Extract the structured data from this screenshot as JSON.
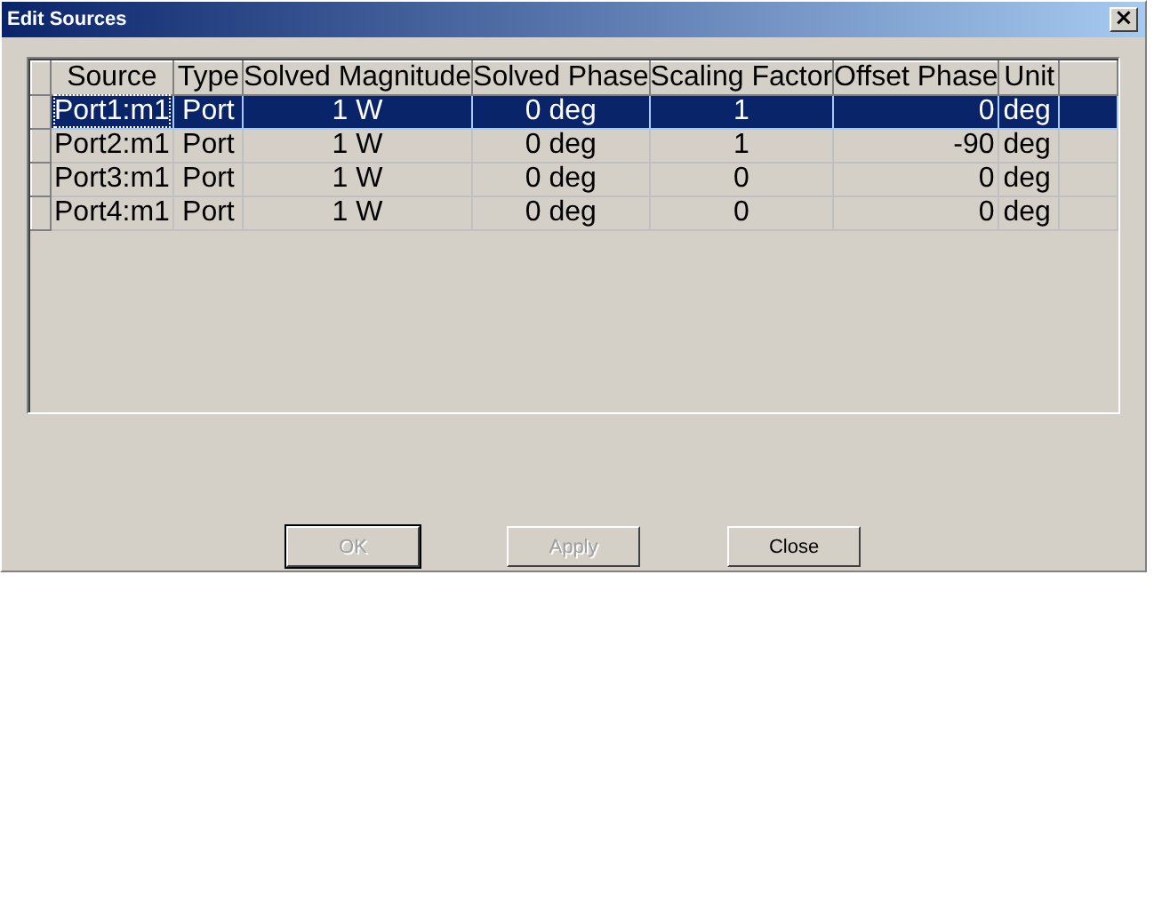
{
  "window": {
    "title": "Edit Sources",
    "close": "×"
  },
  "table": {
    "columns": [
      "Source",
      "Type",
      "Solved Magnitude",
      "Solved Phase",
      "Scaling Factor",
      "Offset Phase",
      "Unit"
    ],
    "rows": [
      {
        "cells": [
          "Port1:m1",
          "Port",
          "1 W",
          "0 deg",
          "1",
          "0",
          "deg"
        ],
        "selected": true
      },
      {
        "cells": [
          "Port2:m1",
          "Port",
          "1 W",
          "0 deg",
          "1",
          "-90",
          "deg"
        ],
        "selected": false
      },
      {
        "cells": [
          "Port3:m1",
          "Port",
          "1 W",
          "0 deg",
          "0",
          "0",
          "deg"
        ],
        "selected": false
      },
      {
        "cells": [
          "Port4:m1",
          "Port",
          "1 W",
          "0 deg",
          "0",
          "0",
          "deg"
        ],
        "selected": false
      }
    ]
  },
  "buttons": [
    {
      "label": "OK",
      "disabled": true,
      "default": true
    },
    {
      "label": "Apply",
      "disabled": true,
      "default": false
    },
    {
      "label": "Close",
      "disabled": false,
      "default": false
    }
  ]
}
